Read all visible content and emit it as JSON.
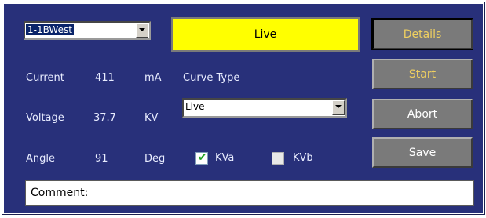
{
  "device_select": {
    "value": "1-1BWest"
  },
  "status": {
    "text": "Live"
  },
  "readings": {
    "current": {
      "label": "Current",
      "value": "411",
      "unit": "mA"
    },
    "voltage": {
      "label": "Voltage",
      "value": "37.7",
      "unit": "KV"
    },
    "angle": {
      "label": "Angle",
      "value": "91",
      "unit": "Deg"
    }
  },
  "curve_type": {
    "label": "Curve Type",
    "value": "Live"
  },
  "checkboxes": {
    "kva": {
      "label": "KVa",
      "checked": true
    },
    "kvb": {
      "label": "KVb",
      "checked": false
    }
  },
  "buttons": {
    "details": "Details",
    "start": "Start",
    "abort": "Abort",
    "save": "Save"
  },
  "comment": {
    "label": "Comment:"
  },
  "colors": {
    "panel_bg": "#28307a",
    "status_bg": "#ffff00",
    "button_bg": "#7a7a7a",
    "button_text_gold": "#f0d060",
    "button_text_white": "#ffffff"
  }
}
